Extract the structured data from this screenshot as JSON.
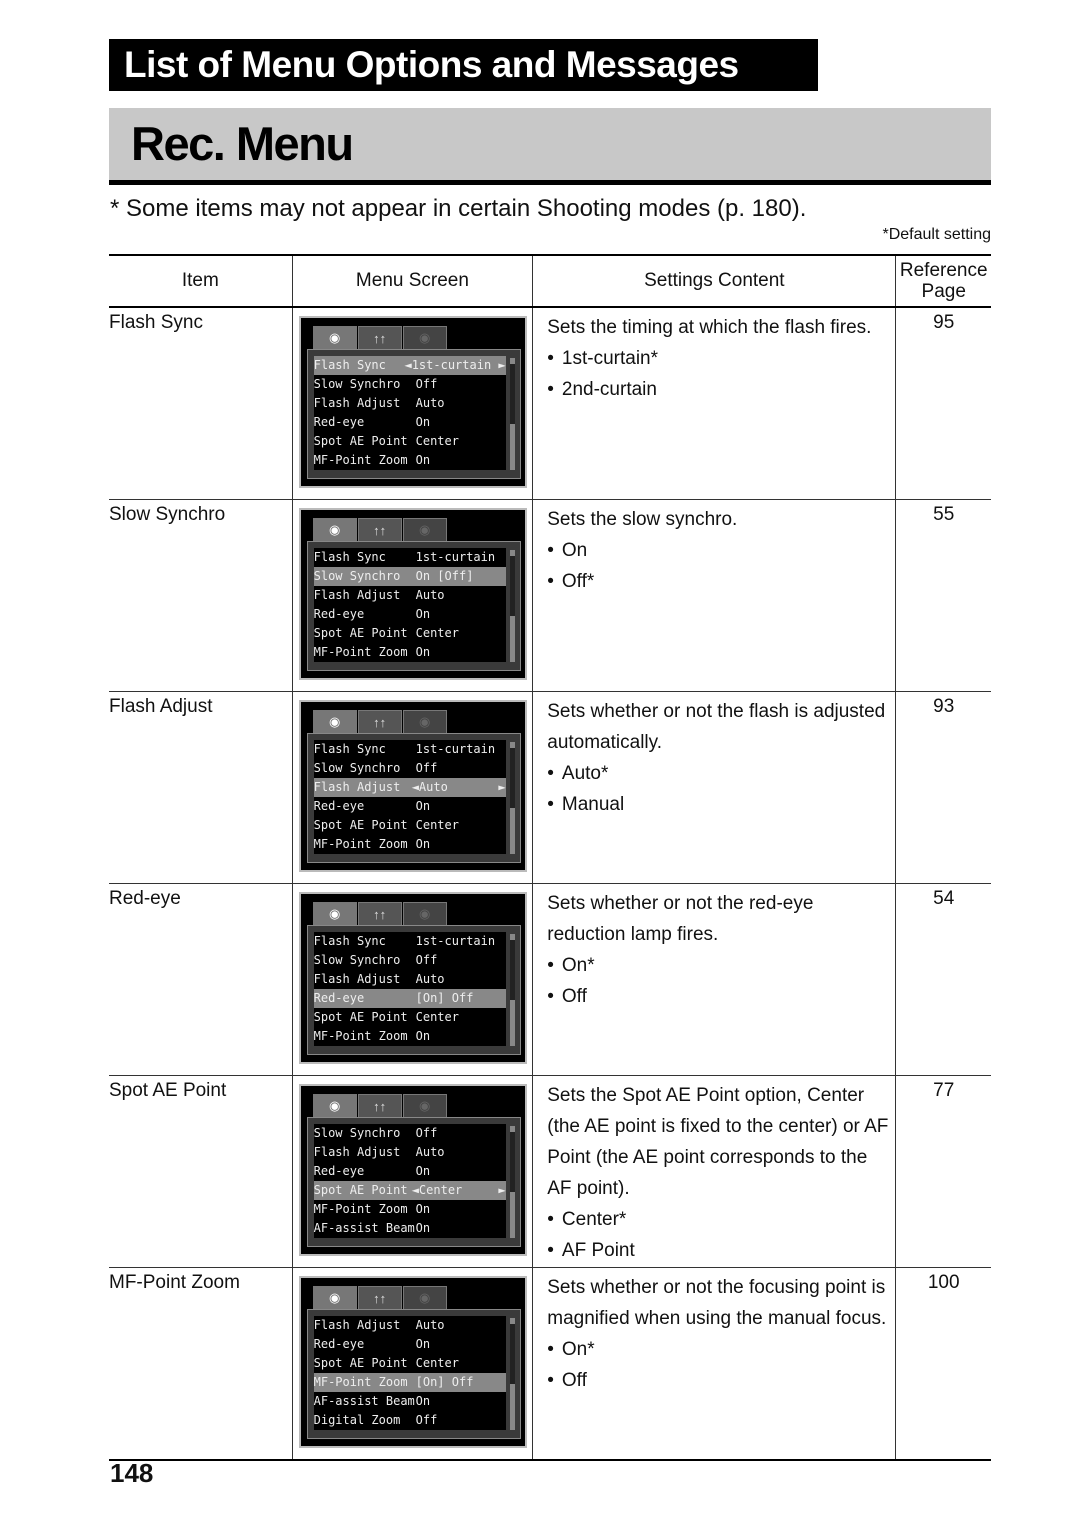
{
  "header": {
    "section_title": "List of Menu Options and Messages",
    "chapter_title": "Rec. Menu"
  },
  "note": "* Some items may not appear in certain Shooting modes (p. 180).",
  "default_note": "*Default setting",
  "table": {
    "headers": [
      "Item",
      "Menu Screen",
      "Settings Content",
      "Reference Page"
    ],
    "rows": [
      {
        "item": "Flash Sync",
        "description": "Sets the timing at which the flash fires.",
        "options": [
          "1st-curtain*",
          "2nd-curtain"
        ],
        "page": "95",
        "screen": [
          [
            "Flash Sync",
            "◄1st-curtain ►",
            true
          ],
          [
            "Slow Synchro",
            "Off",
            false
          ],
          [
            "Flash Adjust",
            "Auto",
            false
          ],
          [
            "Red-eye",
            "On",
            false
          ],
          [
            "Spot AE Point",
            "Center",
            false
          ],
          [
            "MF-Point Zoom",
            "On",
            false
          ]
        ]
      },
      {
        "item": "Slow Synchro",
        "description": "Sets the slow synchro.",
        "options": [
          "On",
          "Off*"
        ],
        "page": "55",
        "screen": [
          [
            "Flash Sync",
            "1st-curtain",
            false
          ],
          [
            "Slow Synchro",
            "On [Off]",
            true
          ],
          [
            "Flash Adjust",
            "Auto",
            false
          ],
          [
            "Red-eye",
            "On",
            false
          ],
          [
            "Spot AE Point",
            "Center",
            false
          ],
          [
            "MF-Point Zoom",
            "On",
            false
          ]
        ]
      },
      {
        "item": "Flash Adjust",
        "description": "Sets whether or not the flash is adjusted automatically.",
        "options": [
          "Auto*",
          "Manual"
        ],
        "page": "93",
        "screen": [
          [
            "Flash Sync",
            "1st-curtain",
            false
          ],
          [
            "Slow Synchro",
            "Off",
            false
          ],
          [
            "Flash Adjust",
            "◄Auto       ►",
            true
          ],
          [
            "Red-eye",
            "On",
            false
          ],
          [
            "Spot AE Point",
            "Center",
            false
          ],
          [
            "MF-Point Zoom",
            "On",
            false
          ]
        ]
      },
      {
        "item": "Red-eye",
        "description": "Sets whether or not the red-eye reduction lamp fires.",
        "options": [
          "On*",
          "Off"
        ],
        "page": "54",
        "screen": [
          [
            "Flash Sync",
            "1st-curtain",
            false
          ],
          [
            "Slow Synchro",
            "Off",
            false
          ],
          [
            "Flash Adjust",
            "Auto",
            false
          ],
          [
            "Red-eye",
            "[On] Off",
            true
          ],
          [
            "Spot AE Point",
            "Center",
            false
          ],
          [
            "MF-Point Zoom",
            "On",
            false
          ]
        ]
      },
      {
        "item": "Spot AE Point",
        "description": "Sets the Spot AE Point option, Center (the AE point is fixed to the center) or AF Point (the AE point corresponds to the AF point).",
        "options": [
          "Center*",
          "AF Point"
        ],
        "page": "77",
        "screen": [
          [
            "Slow Synchro",
            "Off",
            false
          ],
          [
            "Flash Adjust",
            "Auto",
            false
          ],
          [
            "Red-eye",
            "On",
            false
          ],
          [
            "Spot AE Point",
            "◄Center     ►",
            true
          ],
          [
            "MF-Point Zoom",
            "On",
            false
          ],
          [
            "AF-assist Beam",
            "On",
            false
          ]
        ]
      },
      {
        "item": "MF-Point Zoom",
        "description": "Sets whether or not the focusing point is magnified when using the manual focus.",
        "options": [
          "On*",
          "Off"
        ],
        "page": "100",
        "screen": [
          [
            "Flash Adjust",
            "Auto",
            false
          ],
          [
            "Red-eye",
            "On",
            false
          ],
          [
            "Spot AE Point",
            "Center",
            false
          ],
          [
            "MF-Point Zoom",
            "[On] Off",
            true
          ],
          [
            "AF-assist Beam",
            "On",
            false
          ],
          [
            "Digital Zoom",
            "Off",
            false
          ]
        ]
      }
    ]
  },
  "tab_icons": [
    "camera-icon",
    "tools-icon",
    "my-camera-icon"
  ],
  "page_number": "148"
}
